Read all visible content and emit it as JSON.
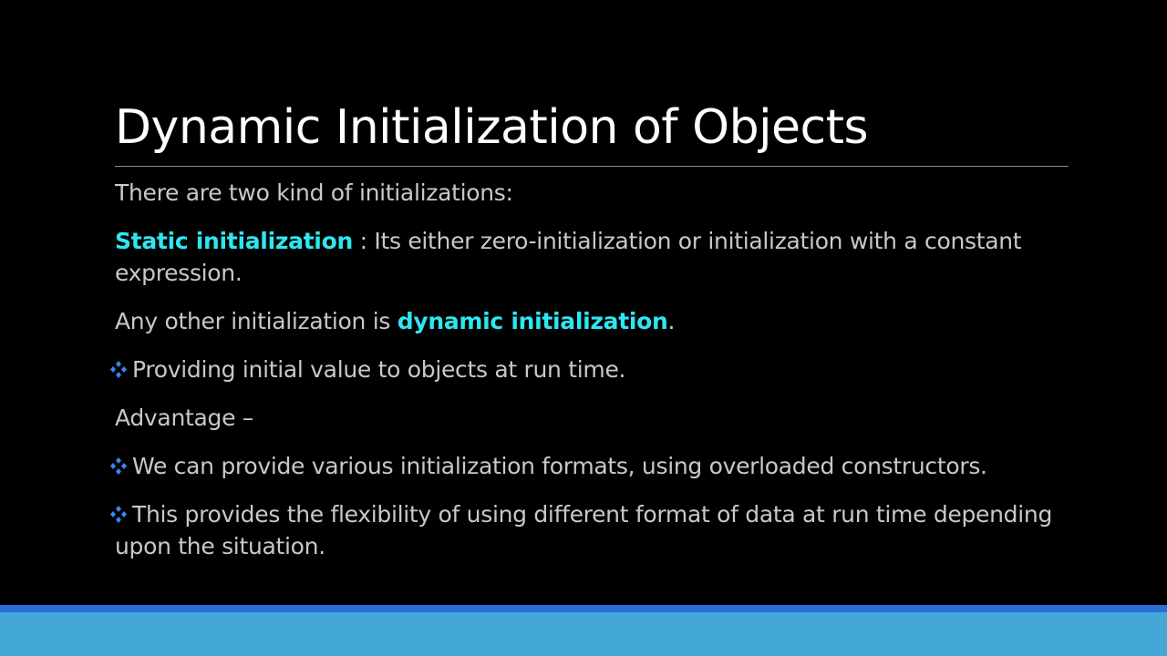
{
  "slide": {
    "title": "Dynamic Initialization of Objects",
    "colors": {
      "background": "#000000",
      "title": "#ffffff",
      "body": "#c8c8c8",
      "highlight": "#2fe6f0",
      "bullet": "#3a86f0",
      "footer_dark": "#2a6fd6",
      "footer_light": "#43a7d8"
    },
    "bullet_icon": "diamond-bullet-icon",
    "paragraphs": {
      "p1": {
        "text": "There are two kind of initializations:"
      },
      "p2": {
        "term": "Static initialization",
        "text": " : Its either zero-initialization or initialization with a constant expression."
      },
      "p3": {
        "text": "Any other initialization is ",
        "term": "dynamic initialization",
        "suffix": "."
      },
      "p4": {
        "text": "Providing initial value to objects at run time."
      },
      "p5": {
        "text": "Advantage –"
      },
      "p6": {
        "text": "We can provide various initialization formats, using overloaded constructors."
      },
      "p7": {
        "text": "This provides the flexibility of using different format of data at run time depending upon the situation."
      }
    }
  }
}
